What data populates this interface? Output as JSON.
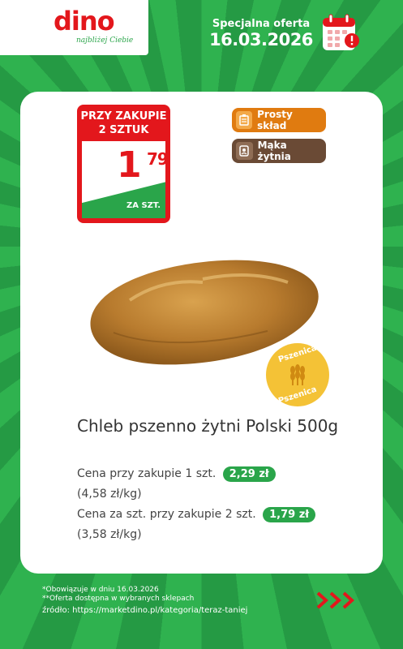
{
  "brand": {
    "name": "dino",
    "tagline": "najbliżej Ciebie"
  },
  "offer": {
    "title": "Specjalna oferta",
    "date": "16.03.2026"
  },
  "price_tag": {
    "condition_line1": "PRZY ZAKUPIE",
    "condition_line2": "2 SZTUK",
    "price_int": "1",
    "price_dec": "79",
    "unit": "ZA SZT."
  },
  "chips": [
    {
      "label": "Prosty skład",
      "icon": "simple-ingredients-icon"
    },
    {
      "label": "Mąka żytnia",
      "icon": "rye-flour-icon"
    }
  ],
  "badge": {
    "top_text": "Pszenica",
    "bottom_text": "Pszenica",
    "icon": "wheat-icon"
  },
  "product": {
    "name": "Chleb pszenno żytni Polski 500g",
    "price_single_label": "Cena przy zakupie 1 szt.",
    "price_single": "2,29 zł",
    "unit_single": "(4,58 zł/kg)",
    "price_double_label": "Cena za szt. przy zakupie 2 szt.",
    "price_double": "1,79 zł",
    "unit_double": "(3,58 zł/kg)"
  },
  "footer": {
    "note1": "*Obowiązuje w dniu 16.03.2026",
    "note2": "**Oferta dostępna w wybranych sklepach",
    "source": "źródło: https://marketdino.pl/kategoria/teraz-taniej"
  },
  "colors": {
    "brand_red": "#e3171c",
    "brand_green": "#2aa54a",
    "chip_orange": "#e07b10",
    "chip_brown": "#6a4a35",
    "badge_yellow": "#f4c236"
  }
}
